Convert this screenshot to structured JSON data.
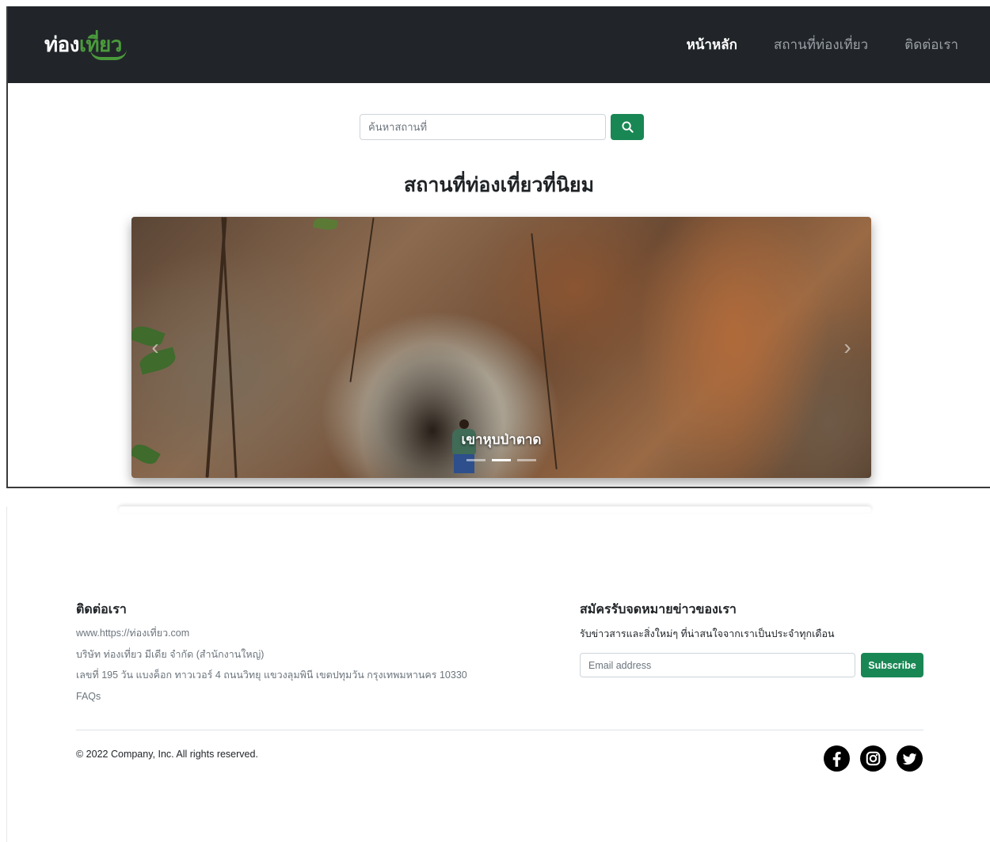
{
  "brand": {
    "logo_part1": "ท่อง",
    "logo_part2": "เที่ยว"
  },
  "nav": {
    "items": [
      {
        "label": "หน้าหลัก",
        "active": true
      },
      {
        "label": "สถานที่ท่องเที่ยว",
        "active": false
      },
      {
        "label": "ติดต่อเรา",
        "active": false
      }
    ]
  },
  "search": {
    "placeholder": "ค้นหาสถานที่",
    "value": "",
    "button_icon": "search-icon"
  },
  "section": {
    "title": "สถานที่ท่องเที่ยวที่นิยม"
  },
  "carousel": {
    "caption": "เขาหุบป่าตาด",
    "slide_count": 3,
    "active_slide": 2
  },
  "footer": {
    "contact": {
      "heading": "ติดต่อเรา",
      "website": "www.https://ท่องเที่ยว.com",
      "company": "บริษัท ท่องเที่ยว มีเดีย จำกัด (สำนักงานใหญ่)",
      "address": "เลขที่ 195 วัน แบงค็อก ทาวเวอร์ 4 ถนนวิทยุ แขวงลุมพินี เขตปทุมวัน กรุงเทพมหานคร 10330",
      "faqs": "FAQs"
    },
    "newsletter": {
      "heading": "สมัครรับจดหมายข่าวของเรา",
      "subtitle": "รับข่าวสารและสิ่งใหม่ๆ ที่น่าสนใจจากเราเป็นประจำทุกเดือน",
      "email_placeholder": "Email address",
      "subscribe_label": "Subscribe"
    },
    "copyright": "© 2022 Company, Inc. All rights reserved.",
    "socials": [
      "facebook-icon",
      "instagram-icon",
      "twitter-icon"
    ]
  },
  "colors": {
    "navbar_bg": "#212529",
    "accent_green": "#198754",
    "logo_green": "#4a9a3c"
  }
}
